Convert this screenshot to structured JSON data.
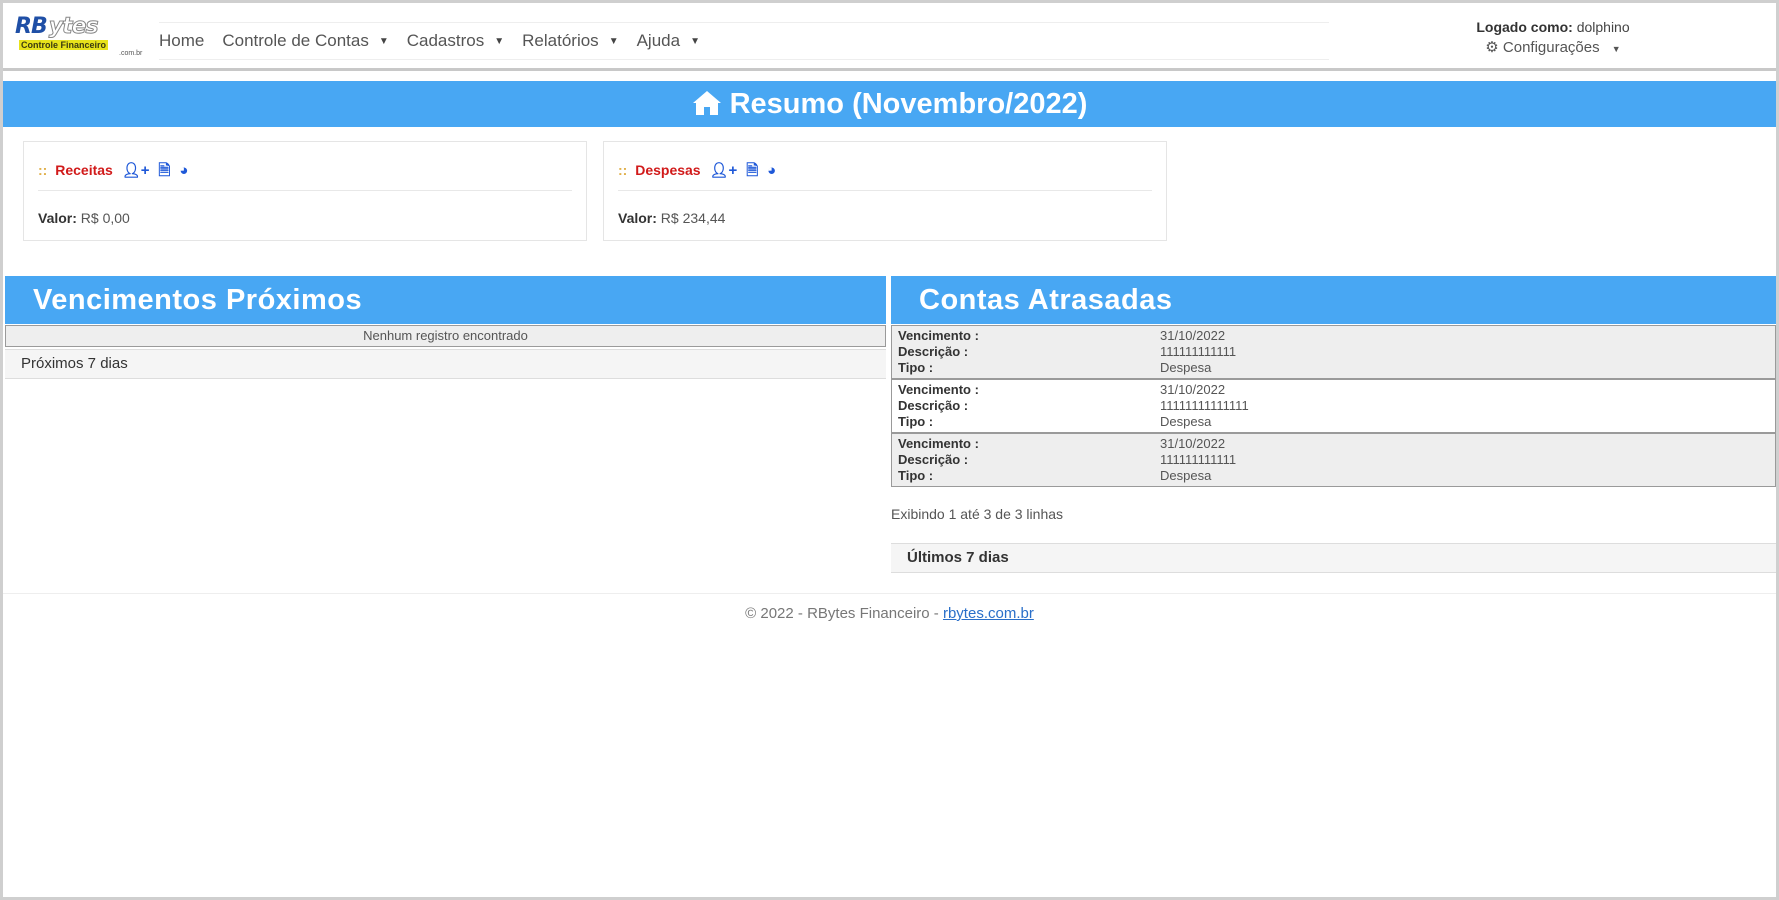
{
  "brand": {
    "logo_main": "RB",
    "logo_ghost": "ytes",
    "logo_sub": "Controle Financeiro",
    "logo_tld": ".com.br"
  },
  "nav": {
    "items": [
      {
        "label": "Home",
        "dropdown": false
      },
      {
        "label": "Controle de Contas",
        "dropdown": true
      },
      {
        "label": "Cadastros",
        "dropdown": true
      },
      {
        "label": "Relatórios",
        "dropdown": true
      },
      {
        "label": "Ajuda",
        "dropdown": true
      }
    ]
  },
  "user": {
    "logged_prefix": "Logado como:",
    "username": "dolphino",
    "config_label": "Configurações"
  },
  "summary": {
    "title": "Resumo (Novembro/2022)",
    "cards": [
      {
        "colons": "::",
        "title": "Receitas",
        "value_label": "Valor:",
        "value": "R$ 0,00"
      },
      {
        "colons": "::",
        "title": "Despesas",
        "value_label": "Valor:",
        "value": "R$ 234,44"
      }
    ]
  },
  "upcoming": {
    "title": "Vencimentos Próximos",
    "empty_message": "Nenhum registro encontrado",
    "footer": "Próximos 7 dias"
  },
  "overdue": {
    "title": "Contas Atrasadas",
    "labels": {
      "due": "Vencimento :",
      "description": "Descrição :",
      "type": "Tipo :"
    },
    "rows": [
      {
        "due": "31/10/2022",
        "description": "111111111111",
        "type": "Despesa"
      },
      {
        "due": "31/10/2022",
        "description": "11111111111111",
        "type": "Despesa"
      },
      {
        "due": "31/10/2022",
        "description": "111111111111",
        "type": "Despesa"
      }
    ],
    "showing": "Exibindo 1 até 3 de 3 linhas",
    "footer": "Últimos 7 dias"
  },
  "footer": {
    "text": "© 2022 - RBytes Financeiro - ",
    "link": "rbytes.com.br"
  },
  "colors": {
    "accent": "#48a7f3",
    "danger": "#d11a1a",
    "icon_blue": "#1e58d8"
  }
}
